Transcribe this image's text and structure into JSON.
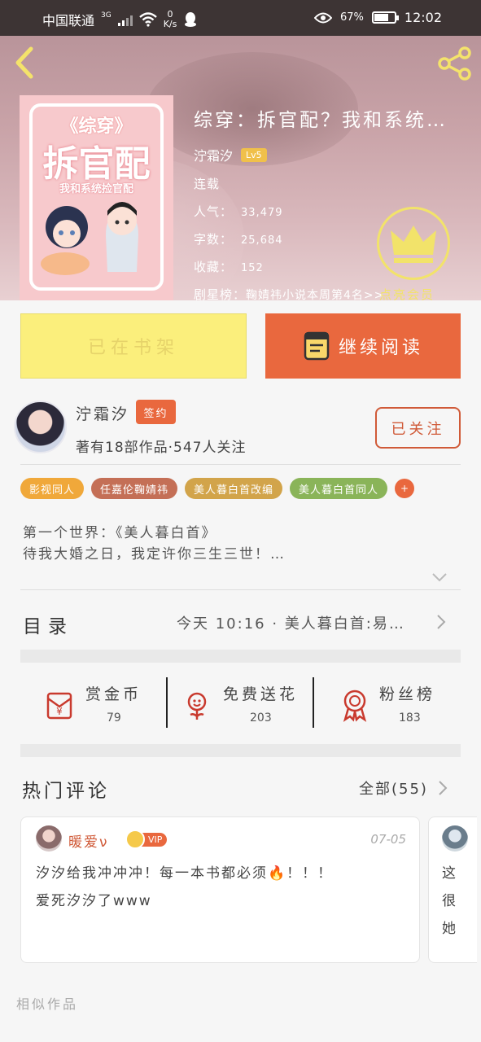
{
  "status_bar": {
    "carrier": "中国联通",
    "network": "3G",
    "net_speed_value": "0",
    "net_speed_unit": "K/s",
    "battery": "67%",
    "time": "12:02"
  },
  "book": {
    "title": "综穿：拆官配？我和系统…",
    "author": "泞霜汐",
    "author_level": "Lv5",
    "status": "连载",
    "popularity_label": "人气：",
    "popularity": "33,479",
    "word_count_label": "字数：",
    "word_count": "25,684",
    "favorites_label": "收藏：",
    "favorites": "152",
    "ranking_label": "剧星榜：",
    "ranking": "鞠婧祎小说本周第4名>>",
    "cover_text": {
      "line1": "《综穿》",
      "line2": "拆官配",
      "line3": "我和系统捡官配"
    }
  },
  "vip_badge": {
    "label": "点亮会员"
  },
  "actions": {
    "shelf": "已在书架",
    "read": "继续阅读"
  },
  "author_card": {
    "name": "泞霜汐",
    "badge": "签约",
    "stats": "著有18部作品·547人关注",
    "follow": "已关注"
  },
  "tags": [
    {
      "label": "影视同人",
      "color": "#f0a83a"
    },
    {
      "label": "任嘉伦鞠婧祎",
      "color": "#c46f56"
    },
    {
      "label": "美人暮白首改编",
      "color": "#d2a44a"
    },
    {
      "label": "美人暮白首同人",
      "color": "#8ab459"
    }
  ],
  "tags_more": "+",
  "intro": {
    "line1": "第一个世界：《美人暮白首》",
    "line2": "待我大婚之日，我定许你三生三世！…"
  },
  "catalog": {
    "label": "目录",
    "latest": "今天 10:16 · 美人暮白首:易…"
  },
  "support": [
    {
      "title": "赏金币",
      "count": "79",
      "icon": "red-envelope-icon"
    },
    {
      "title": "免费送花",
      "count": "203",
      "icon": "flower-icon"
    },
    {
      "title": "粉丝榜",
      "count": "183",
      "icon": "medal-icon"
    }
  ],
  "comments": {
    "title": "热门评论",
    "all_link": "全部(55)",
    "items": [
      {
        "user": "暖爱ν",
        "vip": "VIP",
        "date": "07-05",
        "line1": "汐汐给我冲冲冲！每一本书都必须🔥！！！",
        "line2": "爱死汐汐了www"
      },
      {
        "line1": "这",
        "line2": "很",
        "line3": "她"
      }
    ]
  },
  "similar_label": "相似作品",
  "colors": {
    "accent": "#e9683e",
    "shelf_yellow": "#fbef7c",
    "vip_gold": "#f2e36a"
  }
}
